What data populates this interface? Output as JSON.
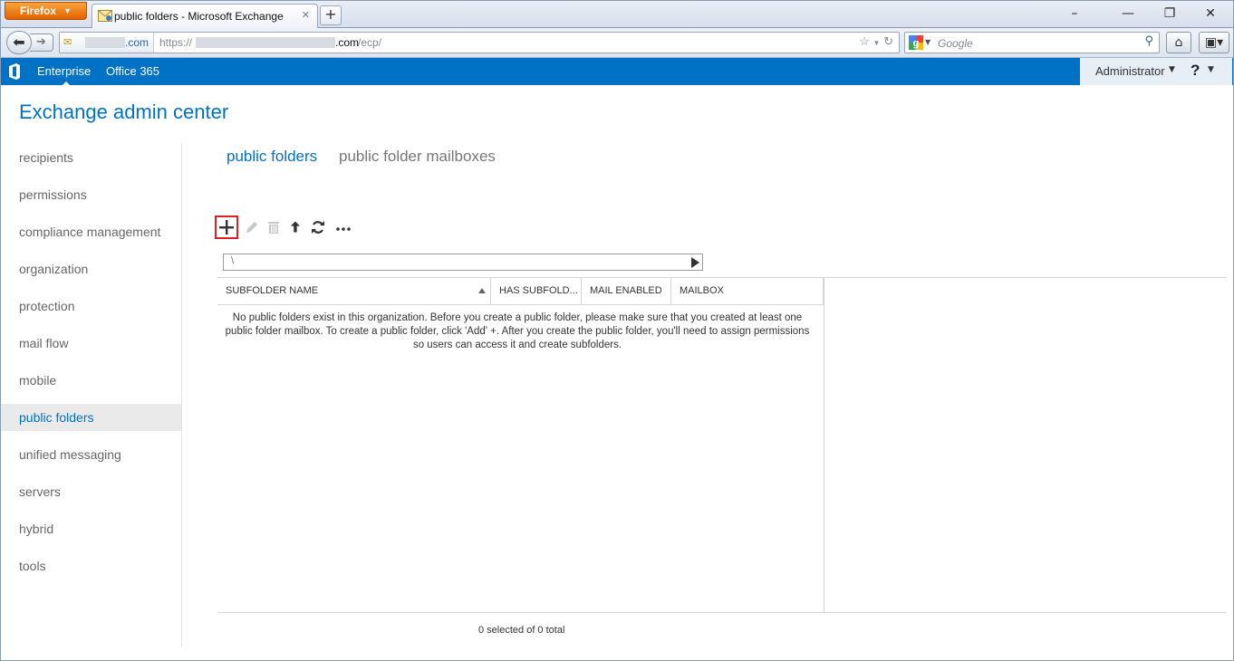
{
  "browser": {
    "app_menu_label": "Firefox",
    "tab_title": "public folders - Microsoft Exchange",
    "new_tab_label": "+",
    "window_controls": {
      "minimize": "–",
      "restore": "❐",
      "close": "✕"
    },
    "site_identity": ".com",
    "url_scheme": "https://",
    "url_domain": ".com",
    "url_path": "/ecp/",
    "search_placeholder": "Google"
  },
  "header": {
    "brand_links": [
      "Enterprise",
      "Office 365"
    ],
    "user": "Administrator",
    "help_label": "?"
  },
  "app": {
    "title": "Exchange admin center"
  },
  "sidebar": {
    "items": [
      {
        "label": "recipients"
      },
      {
        "label": "permissions"
      },
      {
        "label": "compliance management"
      },
      {
        "label": "organization"
      },
      {
        "label": "protection"
      },
      {
        "label": "mail flow"
      },
      {
        "label": "mobile"
      },
      {
        "label": "public folders"
      },
      {
        "label": "unified messaging"
      },
      {
        "label": "servers"
      },
      {
        "label": "hybrid"
      },
      {
        "label": "tools"
      }
    ],
    "active_index": 7
  },
  "main": {
    "tabs": [
      {
        "label": "public folders"
      },
      {
        "label": "public folder mailboxes"
      }
    ],
    "active_tab": 0,
    "toolbar": {
      "icons": [
        "add-icon",
        "edit-icon",
        "delete-icon",
        "move-up-icon",
        "refresh-icon",
        "more-icon"
      ]
    },
    "path": "\\",
    "table": {
      "columns": [
        "SUBFOLDER NAME",
        "HAS SUBFOLD...",
        "MAIL ENABLED",
        "MAILBOX"
      ],
      "empty_message": "No public folders exist in this organization. Before you create a public folder, please make sure that you created at least one public folder mailbox. To create a public folder, click 'Add' +. After you create the public folder, you'll need to assign permissions so users can access it and create subfolders."
    },
    "status": "0 selected of 0 total"
  },
  "colors": {
    "brand_blue": "#0072c6",
    "highlight_red": "#e02020",
    "nav_active_bg": "#eaeaea"
  }
}
